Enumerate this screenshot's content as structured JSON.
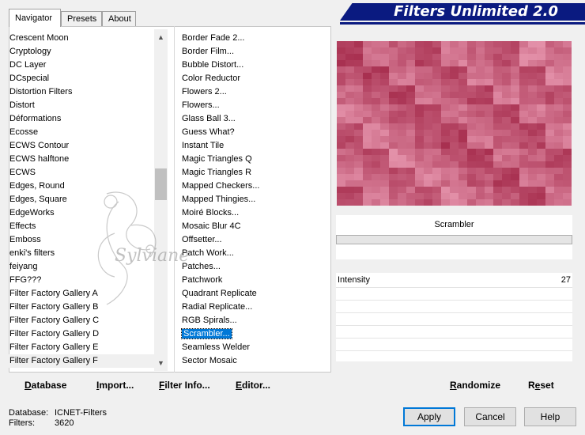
{
  "tabs": [
    {
      "label": "Navigator",
      "active": true
    },
    {
      "label": "Presets",
      "active": false
    },
    {
      "label": "About",
      "active": false
    }
  ],
  "title": "Filters Unlimited 2.0",
  "categories": [
    "Crescent Moon",
    "Cryptology",
    "DC Layer",
    "DCspecial",
    "Distortion Filters",
    "Distort",
    "Déformations",
    "Ecosse",
    "ECWS Contour",
    "ECWS halftone",
    "ECWS",
    "Edges, Round",
    "Edges, Square",
    "EdgeWorks",
    "Effects",
    "Emboss",
    "enki's filters",
    "feiyang",
    "FFG???",
    "Filter Factory Gallery A",
    "Filter Factory Gallery B",
    "Filter Factory Gallery C",
    "Filter Factory Gallery D",
    "Filter Factory Gallery E",
    "Filter Factory Gallery F"
  ],
  "selected_category": "Filter Factory Gallery F",
  "filters": [
    "Border Fade 2...",
    "Border Film...",
    "Bubble Distort...",
    "Color Reductor",
    "Flowers 2...",
    "Flowers...",
    "Glass Ball 3...",
    "Guess What?",
    "Instant Tile",
    "Magic Triangles Q",
    "Magic Triangles R",
    "Mapped Checkers...",
    "Mapped Thingies...",
    "Moiré Blocks...",
    "Mosaic Blur 4C",
    "Offsetter...",
    "Patch Work...",
    "Patches...",
    "Patchwork",
    "Quadrant Replicate",
    "Radial Replicate...",
    "RGB Spirals...",
    "Scrambler...",
    "Seamless Welder",
    "Sector Mosaic"
  ],
  "selected_filter": "Scrambler...",
  "preview": {
    "filter_name": "Scrambler",
    "colors": {
      "base": "#c85a7a",
      "light": "#e898b0",
      "dark": "#a83050"
    }
  },
  "params": [
    {
      "label": "Intensity",
      "value": "27"
    }
  ],
  "bottom_links": {
    "database": {
      "label": "Database",
      "mnemonic": "D"
    },
    "import": {
      "label": "Import...",
      "mnemonic": "I"
    },
    "filter_info": {
      "label": "Filter Info...",
      "mnemonic": "F"
    },
    "editor": {
      "label": "Editor...",
      "mnemonic": "E"
    },
    "randomize": {
      "label": "Randomize",
      "mnemonic": "R"
    },
    "reset": {
      "label": "Reset",
      "mnemonic": "e"
    }
  },
  "status": {
    "database_label": "Database:",
    "database_value": "ICNET-Filters",
    "filters_label": "Filters:",
    "filters_value": "3620"
  },
  "buttons": {
    "apply": "Apply",
    "cancel": "Cancel",
    "help": "Help"
  },
  "watermark_text": "Sylviane"
}
